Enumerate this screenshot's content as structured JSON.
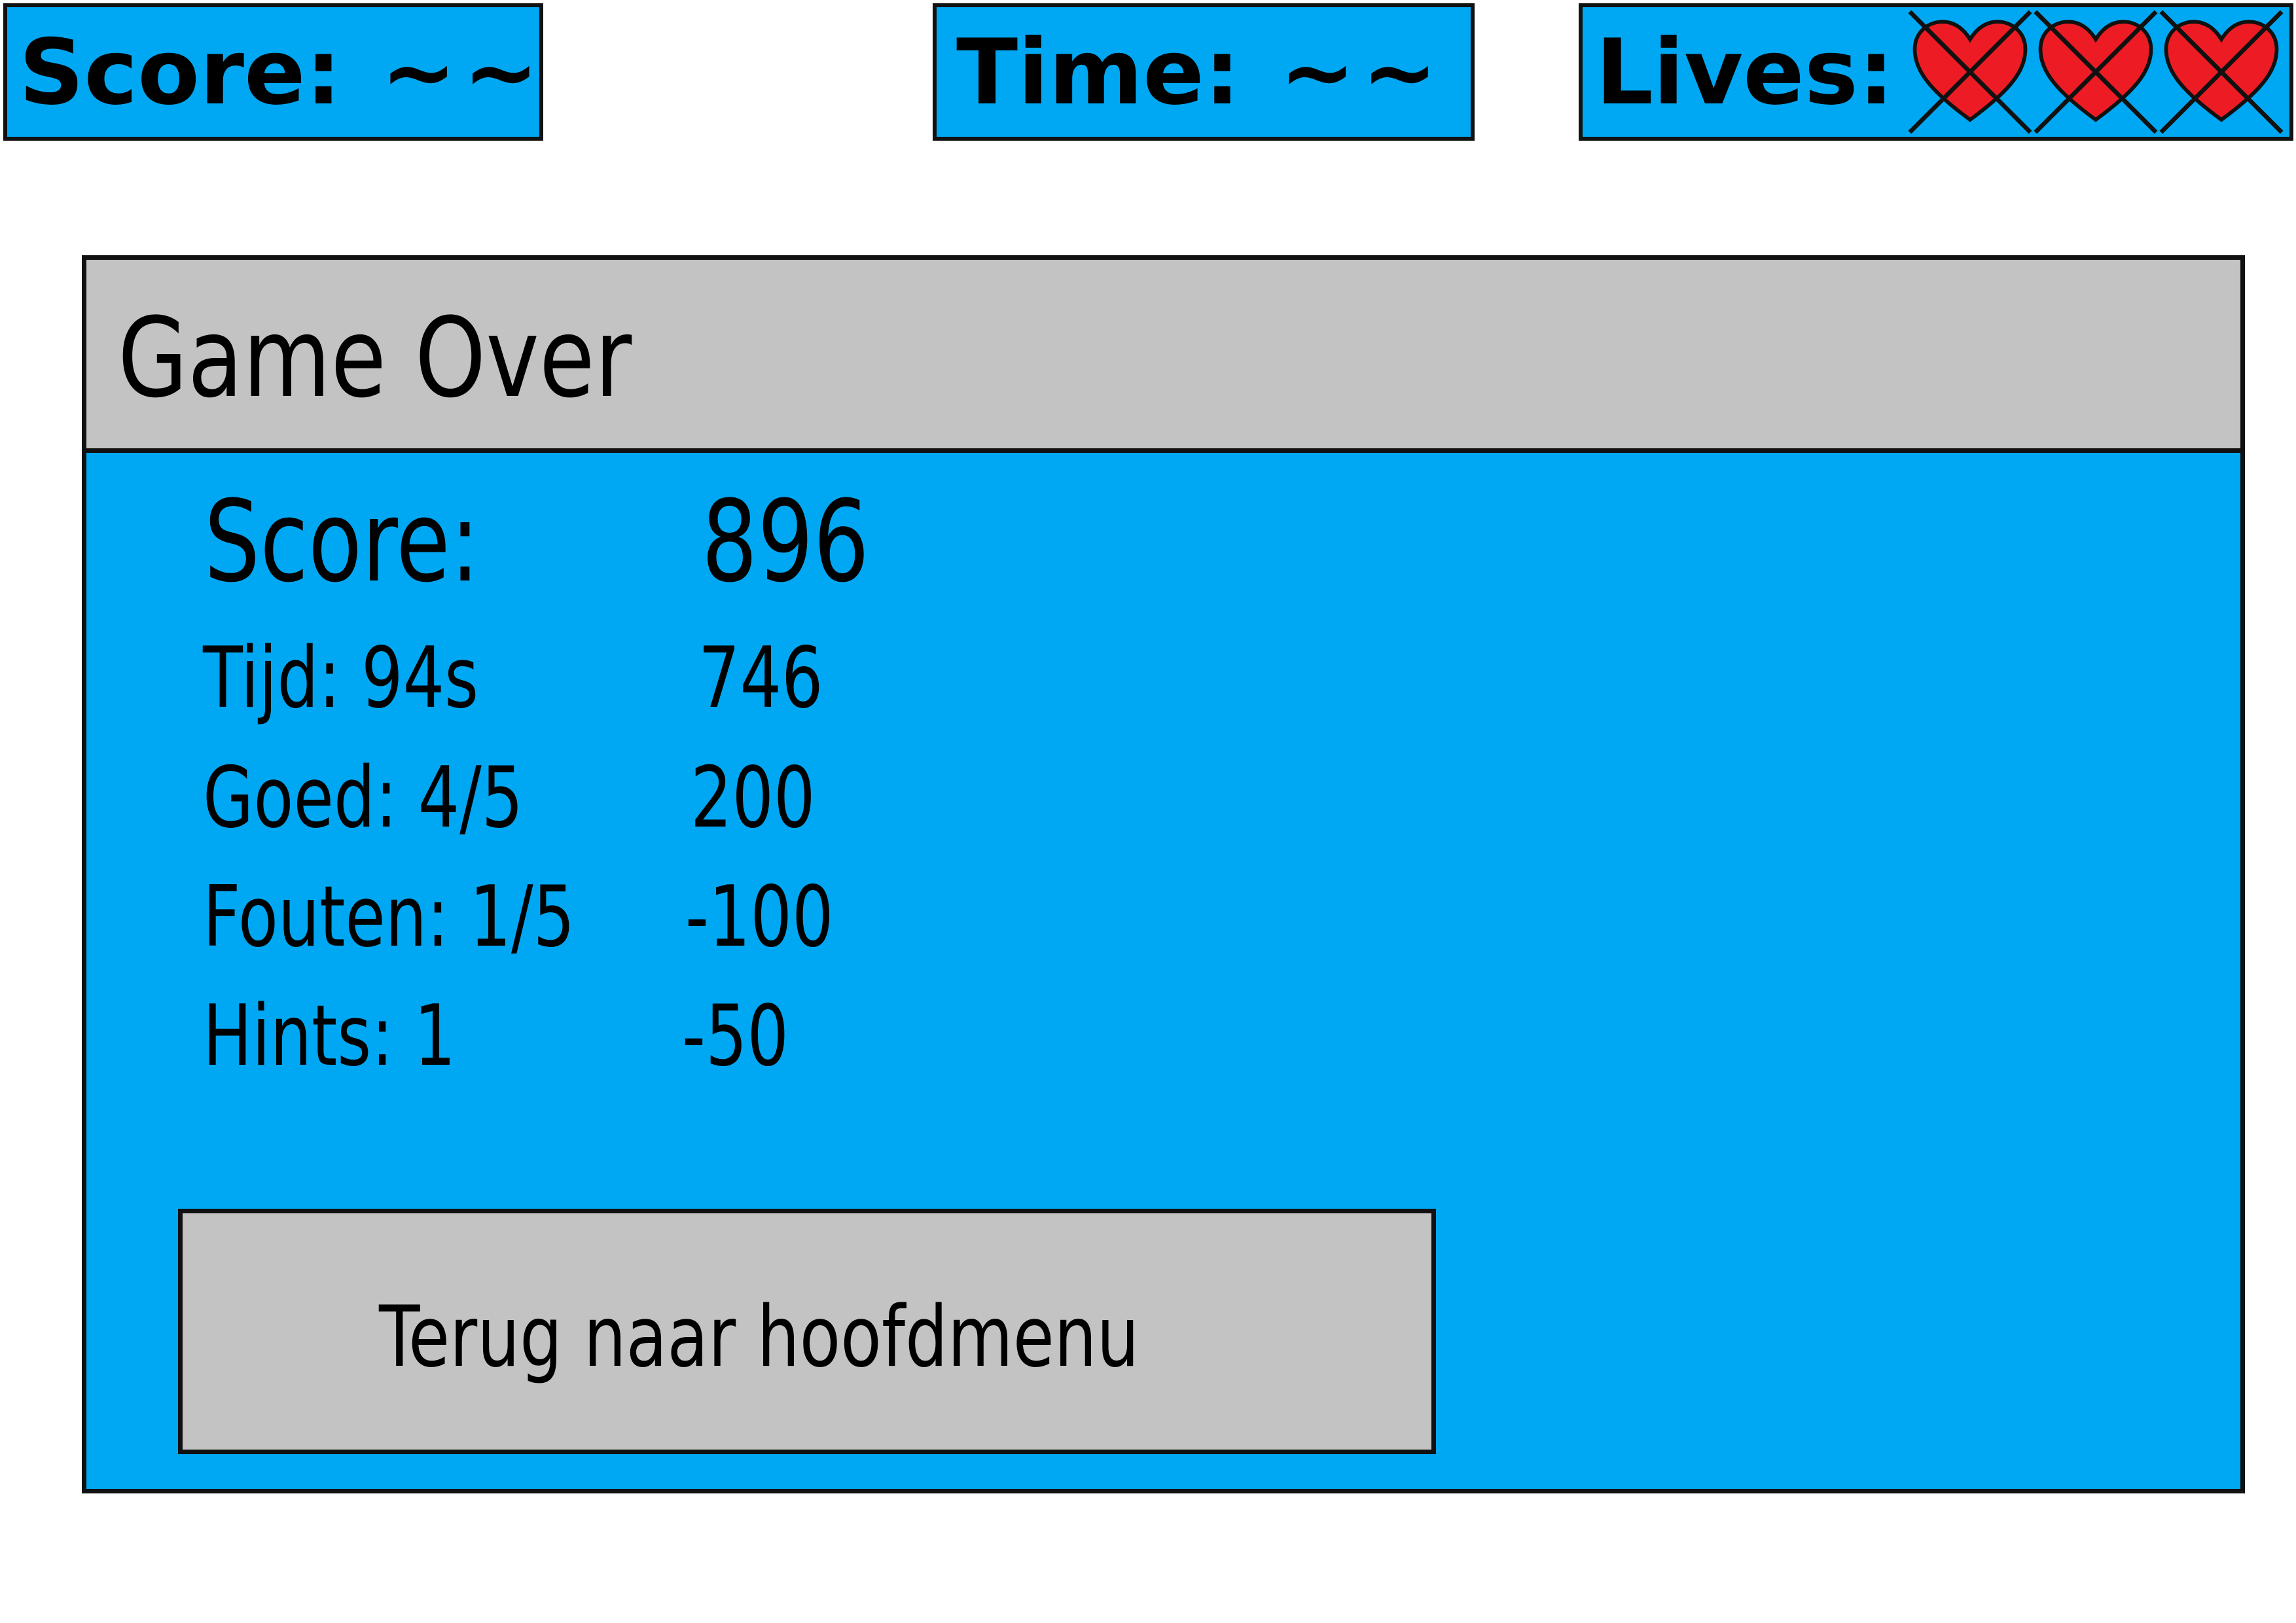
{
  "hud": {
    "score_label": "Score:",
    "score_value": "~~",
    "time_label": "Time:",
    "time_value": "~~",
    "lives_label": "Lives:",
    "lives_total": 3,
    "lives_lost": 3
  },
  "game_over": {
    "title": "Game Over",
    "score_label": "Score:",
    "score_value": "896",
    "breakdown": [
      {
        "label": "Tijd: 94s",
        "value": "746"
      },
      {
        "label": "Goed: 4/5",
        "value": "200"
      },
      {
        "label": "Fouten: 1/5",
        "value": "-100"
      },
      {
        "label": "Hints: 1",
        "value": "-50"
      }
    ],
    "back_button_label": "Terug naar hoofdmenu"
  },
  "colors": {
    "panel_blue": "#00a8f3",
    "header_gray": "#c3c3c3",
    "heart_red": "#ed1c24",
    "border": "#111111"
  },
  "icons": {
    "heart": "heart-icon",
    "lost_marker": "cross-icon"
  }
}
